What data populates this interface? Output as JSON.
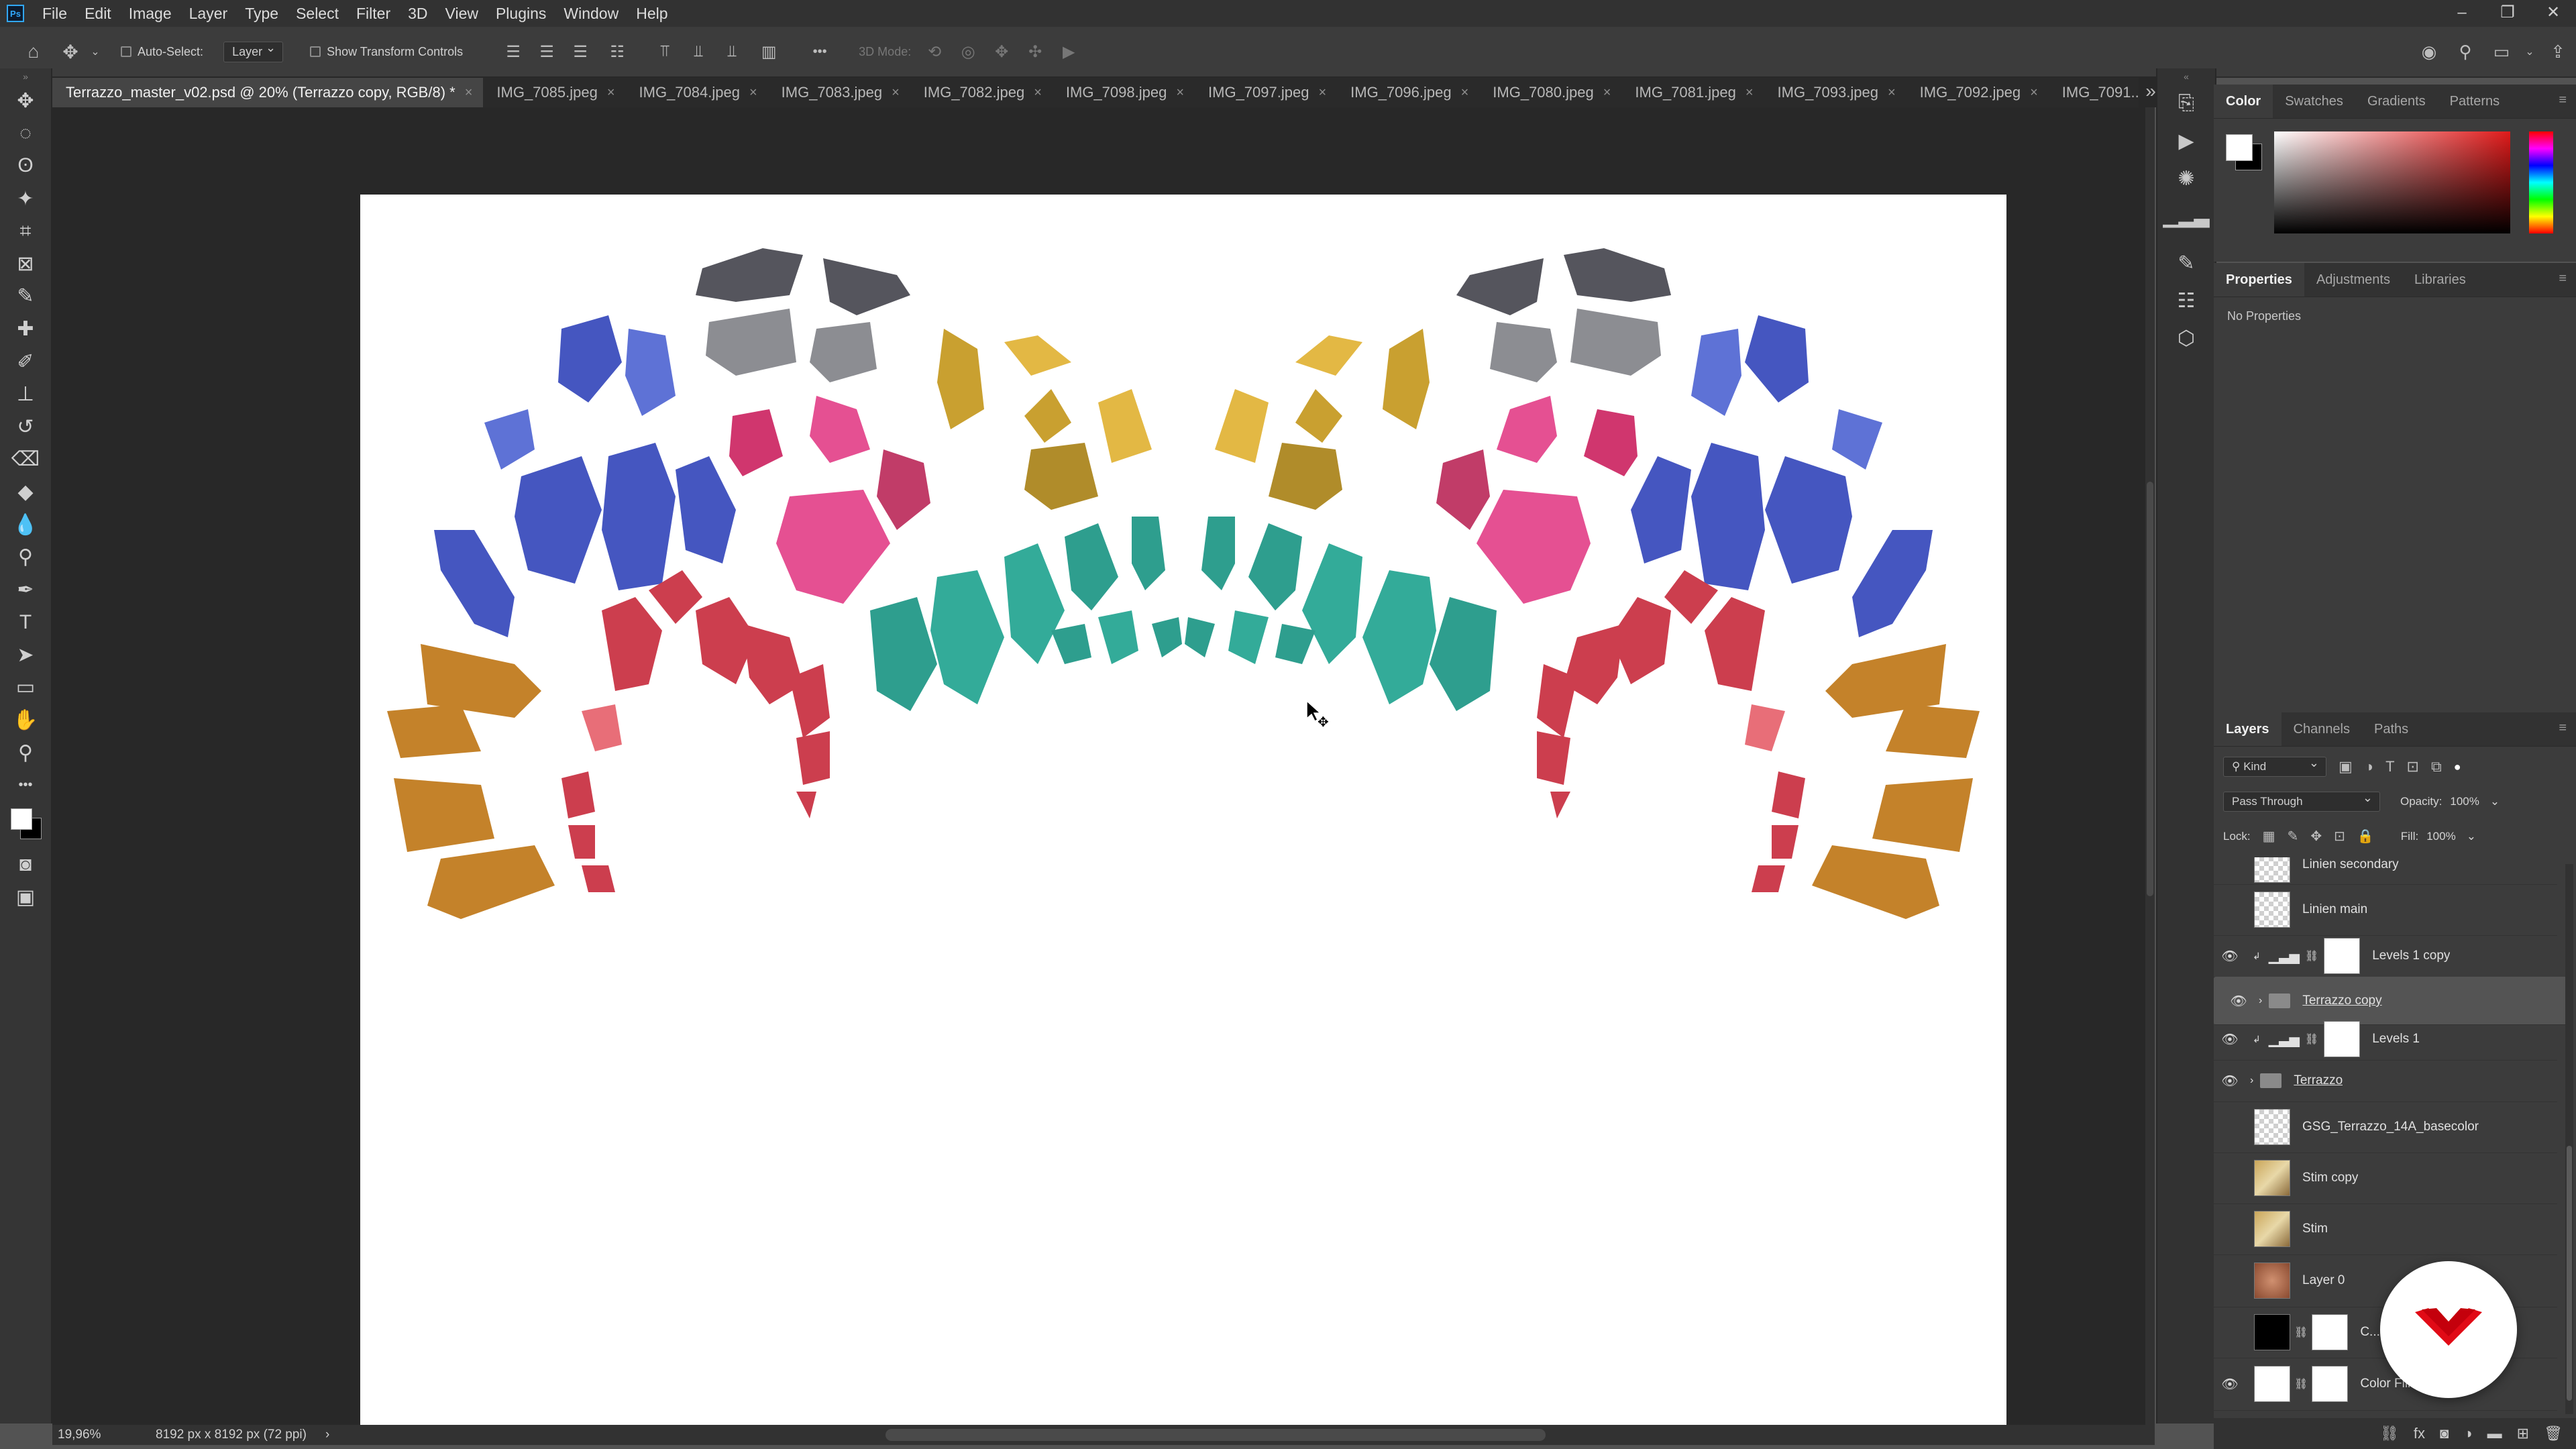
{
  "app": {
    "logo": "Ps",
    "menus": [
      "File",
      "Edit",
      "Image",
      "Layer",
      "Type",
      "Select",
      "Filter",
      "3D",
      "View",
      "Plugins",
      "Window",
      "Help"
    ],
    "window_controls": [
      "–",
      "❐",
      "✕"
    ]
  },
  "options": {
    "auto_select_label": "Auto-Select:",
    "auto_select_target": "Layer",
    "show_transform_label": "Show Transform Controls",
    "mode_3d_label": "3D Mode:",
    "more": "•••"
  },
  "tabs": [
    {
      "label": "Terrazzo_master_v02.psd @ 20% (Terrazzo copy, RGB/8) *",
      "active": true
    },
    {
      "label": "IMG_7085.jpeg"
    },
    {
      "label": "IMG_7084.jpeg"
    },
    {
      "label": "IMG_7083.jpeg"
    },
    {
      "label": "IMG_7082.jpeg"
    },
    {
      "label": "IMG_7098.jpeg"
    },
    {
      "label": "IMG_7097.jpeg"
    },
    {
      "label": "IMG_7096.jpeg"
    },
    {
      "label": "IMG_7080.jpeg"
    },
    {
      "label": "IMG_7081.jpeg"
    },
    {
      "label": "IMG_7093.jpeg"
    },
    {
      "label": "IMG_7092.jpeg"
    },
    {
      "label": "IMG_7091..."
    }
  ],
  "status": {
    "zoom": "19,96%",
    "doc_info": "8192 px x 8192 px (72 ppi)"
  },
  "colors": {
    "accent": "#31a8ff",
    "canvas_bg": "#282828",
    "panel_bg": "#3c3c3c",
    "selected_row": "#545454"
  },
  "color_panel": {
    "tabs": [
      "Color",
      "Swatches",
      "Gradients",
      "Patterns"
    ],
    "active": "Color"
  },
  "properties_panel": {
    "tabs": [
      "Properties",
      "Adjustments",
      "Libraries"
    ],
    "active": "Properties",
    "empty_text": "No Properties"
  },
  "layers_panel": {
    "tabs": [
      "Layers",
      "Channels",
      "Paths"
    ],
    "active": "Layers",
    "filter_kind": "Kind",
    "blend_mode": "Pass Through",
    "opacity_label": "Opacity:",
    "opacity_value": "100%",
    "lock_label": "Lock:",
    "fill_label": "Fill:",
    "fill_value": "100%",
    "layers": [
      {
        "name": "Linien secondary",
        "visible": false,
        "type": "pixel"
      },
      {
        "name": "Linien main",
        "visible": false,
        "type": "pixel"
      },
      {
        "name": "Levels 1 copy",
        "visible": true,
        "type": "adjustment"
      },
      {
        "name": "Terrazzo copy",
        "visible": true,
        "type": "group",
        "selected": true
      },
      {
        "name": "Levels 1",
        "visible": true,
        "type": "adjustment"
      },
      {
        "name": "Terrazzo",
        "visible": true,
        "type": "group"
      },
      {
        "name": "GSG_Terrazzo_14A_basecolor",
        "visible": false,
        "type": "smart"
      },
      {
        "name": "Stim copy",
        "visible": false,
        "type": "smart"
      },
      {
        "name": "Stim",
        "visible": false,
        "type": "smart"
      },
      {
        "name": "Layer 0",
        "visible": false,
        "type": "smart"
      },
      {
        "name": "C...",
        "visible": false,
        "type": "fill"
      },
      {
        "name": "Color Fill...",
        "visible": true,
        "type": "fill"
      }
    ]
  }
}
